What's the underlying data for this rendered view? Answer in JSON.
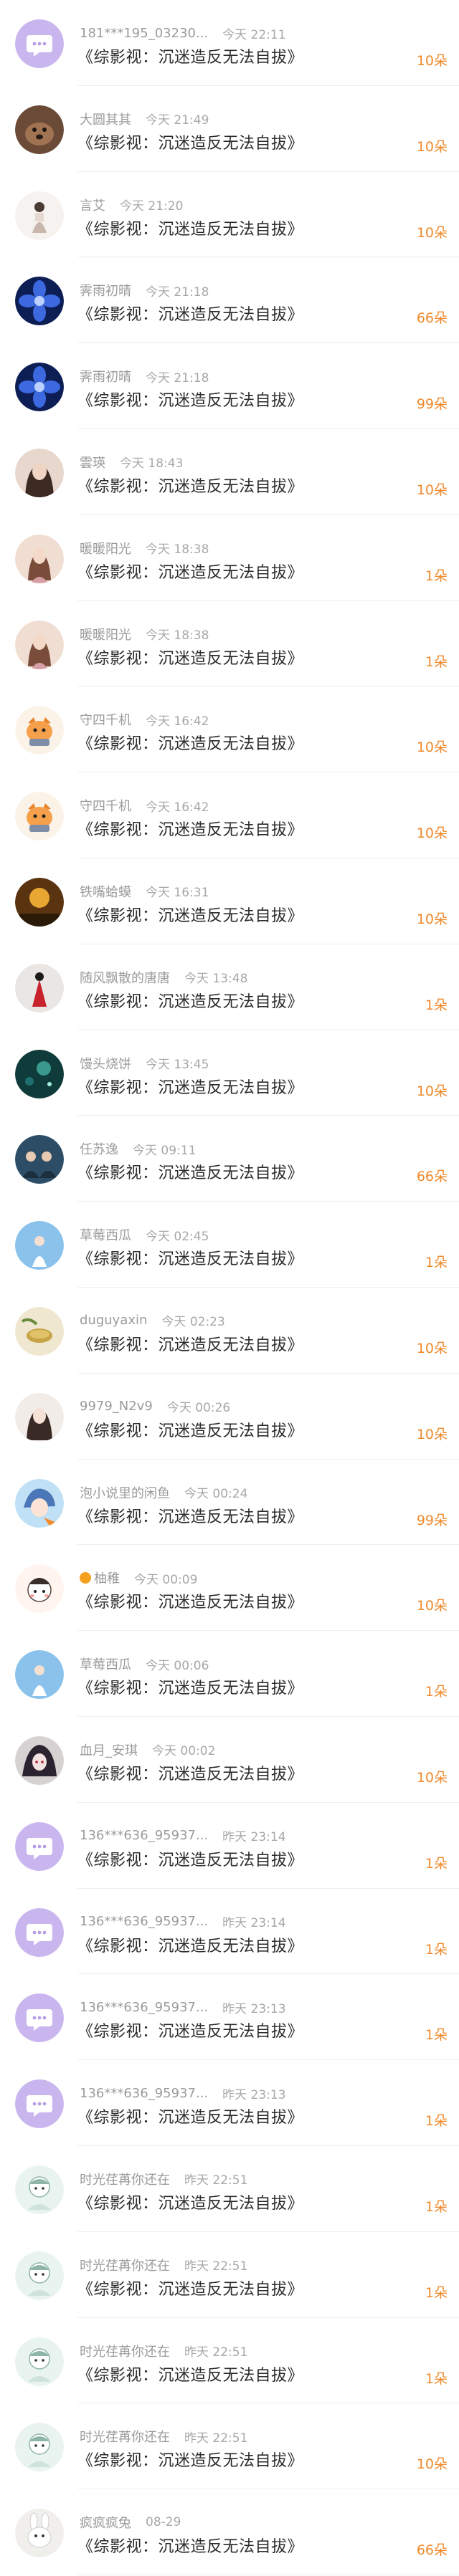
{
  "gift_title": "《综影视：沉迷造反无法自拔》",
  "colors": {
    "amount": "#f0892b",
    "name": "#9b9b9b",
    "text": "#2b2b2b",
    "divider": "#efefef"
  },
  "rows": [
    {
      "name": "181***195_03230...",
      "time": "今天 22:11",
      "amount": "10朵",
      "avatar": "chat-bubble-icon"
    },
    {
      "name": "大圆其其",
      "time": "今天 21:49",
      "amount": "10朵",
      "avatar": "dog-photo"
    },
    {
      "name": "言艾",
      "time": "今天 21:20",
      "amount": "10朵",
      "avatar": "figure-sketch"
    },
    {
      "name": "霁雨初晴",
      "time": "今天 21:18",
      "amount": "66朵",
      "avatar": "blue-flower"
    },
    {
      "name": "霁雨初晴",
      "time": "今天 21:18",
      "amount": "99朵",
      "avatar": "blue-flower"
    },
    {
      "name": "雲瑛",
      "time": "今天 18:43",
      "amount": "10朵",
      "avatar": "girl-portrait"
    },
    {
      "name": "暖暖阳光",
      "time": "今天 18:38",
      "amount": "1朵",
      "avatar": "girl-pink"
    },
    {
      "name": "暖暖阳光",
      "time": "今天 18:38",
      "amount": "1朵",
      "avatar": "girl-pink"
    },
    {
      "name": "守四千机",
      "time": "今天 16:42",
      "amount": "10朵",
      "avatar": "cartoon-cat"
    },
    {
      "name": "守四千机",
      "time": "今天 16:42",
      "amount": "10朵",
      "avatar": "cartoon-cat"
    },
    {
      "name": "铁嘴蛤蟆",
      "time": "今天 16:31",
      "amount": "10朵",
      "avatar": "gold-scene"
    },
    {
      "name": "随风飘散的唐唐",
      "time": "今天 13:48",
      "amount": "1朵",
      "avatar": "red-dress"
    },
    {
      "name": "馒头烧饼",
      "time": "今天 13:45",
      "amount": "10朵",
      "avatar": "night-sky"
    },
    {
      "name": "任苏逸",
      "time": "今天 09:11",
      "amount": "66朵",
      "avatar": "group-photo"
    },
    {
      "name": "草莓西瓜",
      "time": "今天 02:45",
      "amount": "1朵",
      "avatar": "sky-girl"
    },
    {
      "name": "duguyaxin",
      "time": "今天 02:23",
      "amount": "10朵",
      "avatar": "tea-cup"
    },
    {
      "name": "9979_N2v9",
      "time": "今天 00:26",
      "amount": "10朵",
      "avatar": "girl-light"
    },
    {
      "name": "泡小说里的闲鱼",
      "time": "今天 00:24",
      "amount": "99朵",
      "avatar": "anime-character"
    },
    {
      "name": "柚稚",
      "time": "今天 00:09",
      "amount": "10朵",
      "avatar": "cartoon-face"
    },
    {
      "name": "草莓西瓜",
      "time": "今天 00:06",
      "amount": "1朵",
      "avatar": "sky-girl"
    },
    {
      "name": "血月_安琪",
      "time": "今天 00:02",
      "amount": "10朵",
      "avatar": "dark-anime"
    },
    {
      "name": "136***636_95937...",
      "time": "昨天 23:14",
      "amount": "1朵",
      "avatar": "chat-bubble-icon"
    },
    {
      "name": "136***636_95937...",
      "time": "昨天 23:14",
      "amount": "1朵",
      "avatar": "chat-bubble-icon"
    },
    {
      "name": "136***636_95937...",
      "time": "昨天 23:13",
      "amount": "1朵",
      "avatar": "chat-bubble-icon"
    },
    {
      "name": "136***636_95937...",
      "time": "昨天 23:13",
      "amount": "1朵",
      "avatar": "chat-bubble-icon"
    },
    {
      "name": "时光荏苒你还在",
      "time": "昨天 22:51",
      "amount": "1朵",
      "avatar": "cartoon-light"
    },
    {
      "name": "时光荏苒你还在",
      "time": "昨天 22:51",
      "amount": "1朵",
      "avatar": "cartoon-light"
    },
    {
      "name": "时光荏苒你还在",
      "time": "昨天 22:51",
      "amount": "1朵",
      "avatar": "cartoon-light"
    },
    {
      "name": "时光荏苒你还在",
      "time": "昨天 22:51",
      "amount": "10朵",
      "avatar": "cartoon-light"
    },
    {
      "name": "疯疯疯兔",
      "time": "08-29",
      "amount": "66朵",
      "avatar": "white-rabbit"
    }
  ]
}
